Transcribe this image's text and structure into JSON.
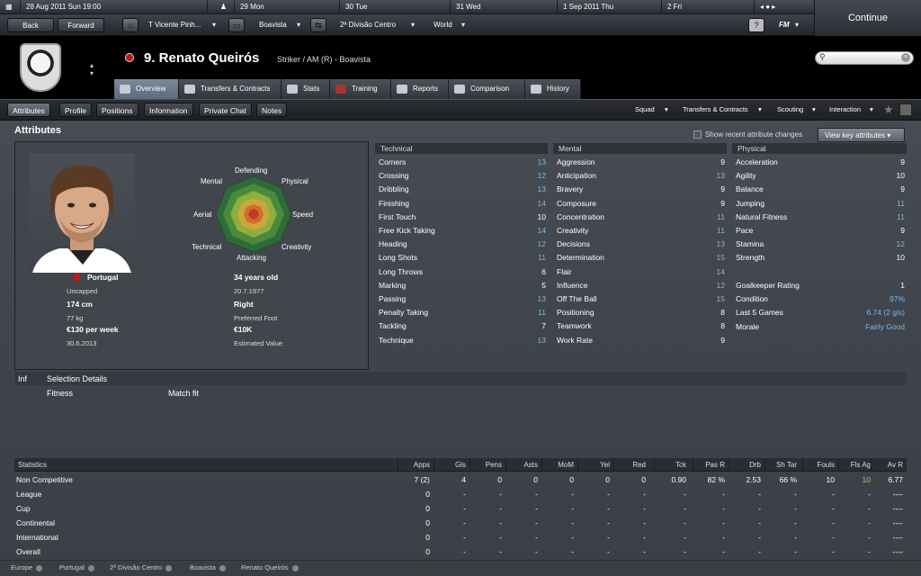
{
  "calendar": {
    "current": "28 Aug 2011 Sun 19:00",
    "days": [
      "29 Mon",
      "30 Tue",
      "31 Wed",
      "1 Sep 2011 Thu",
      "2 Fri"
    ]
  },
  "continue_label": "Continue",
  "nav": {
    "back": "Back",
    "forward": "Forward",
    "manager": "T Vicente Pinh...",
    "club": "Boavista",
    "league": "2ª Divisão Centro",
    "world": "World",
    "help": "?",
    "fm": "FM"
  },
  "player": {
    "name": "9. Renato Queirós",
    "role": "Striker / AM (R) - Boavista"
  },
  "tabs": [
    "Overview",
    "Transfers & Contracts",
    "Stats",
    "Training",
    "Reports",
    "Comparison",
    "History"
  ],
  "subnav": {
    "buttons": [
      "Attributes",
      "Profile",
      "Positions",
      "Information",
      "Private Chat",
      "Notes"
    ],
    "dropdowns": [
      "Squad",
      "Transfers & Contracts",
      "Scouting",
      "Interaction"
    ]
  },
  "section_title": "Attributes",
  "recent_label": "Show recent attribute changes",
  "key_attr_label": "View key attributes",
  "radar": [
    "Defending",
    "Physical",
    "Speed",
    "Creativity",
    "Attacking",
    "Technical",
    "Aerial",
    "Mental"
  ],
  "info": {
    "nation": "Portugal",
    "caps": "Uncapped",
    "height": "174 cm",
    "weight": "77 kg",
    "wage": "€130 per week",
    "contract": "30.6.2013",
    "age": "34 years old",
    "dob": "20.7.1977",
    "foot": "Right",
    "foot_label": "Preferred Foot",
    "value": "€10K",
    "value_label": "Estimated Value"
  },
  "technical": {
    "title": "Technical",
    "rows": [
      {
        "name": "Corners",
        "value": "13"
      },
      {
        "name": "Crossing",
        "value": "12"
      },
      {
        "name": "Dribbling",
        "value": "13"
      },
      {
        "name": "Finishing",
        "value": "14"
      },
      {
        "name": "First Touch",
        "value": "10"
      },
      {
        "name": "Free Kick Taking",
        "value": "14"
      },
      {
        "name": "Heading",
        "value": "12"
      },
      {
        "name": "Long Shots",
        "value": "11"
      },
      {
        "name": "Long Throws",
        "value": "6"
      },
      {
        "name": "Marking",
        "value": "5"
      },
      {
        "name": "Passing",
        "value": "13"
      },
      {
        "name": "Penalty Taking",
        "value": "11"
      },
      {
        "name": "Tackling",
        "value": "7"
      },
      {
        "name": "Technique",
        "value": "13"
      }
    ]
  },
  "mental": {
    "title": "Mental",
    "rows": [
      {
        "name": "Aggression",
        "value": "9"
      },
      {
        "name": "Anticipation",
        "value": "13"
      },
      {
        "name": "Bravery",
        "value": "9"
      },
      {
        "name": "Composure",
        "value": "9"
      },
      {
        "name": "Concentration",
        "value": "11"
      },
      {
        "name": "Creativity",
        "value": "11"
      },
      {
        "name": "Decisions",
        "value": "13"
      },
      {
        "name": "Determination",
        "value": "15"
      },
      {
        "name": "Flair",
        "value": "14"
      },
      {
        "name": "Influence",
        "value": "12"
      },
      {
        "name": "Off The Ball",
        "value": "15"
      },
      {
        "name": "Positioning",
        "value": "8"
      },
      {
        "name": "Teamwork",
        "value": "8"
      },
      {
        "name": "Work Rate",
        "value": "9"
      }
    ]
  },
  "physical": {
    "title": "Physical",
    "rows": [
      {
        "name": "Acceleration",
        "value": "9"
      },
      {
        "name": "Agility",
        "value": "10"
      },
      {
        "name": "Balance",
        "value": "9"
      },
      {
        "name": "Jumping",
        "value": "11"
      },
      {
        "name": "Natural Fitness",
        "value": "11"
      },
      {
        "name": "Pace",
        "value": "9"
      },
      {
        "name": "Stamina",
        "value": "12"
      },
      {
        "name": "Strength",
        "value": "10"
      }
    ],
    "extra": [
      {
        "name": "Goalkeeper Rating",
        "value": "1"
      },
      {
        "name": "Condition",
        "value": "97%"
      },
      {
        "name": "Last 5 Games",
        "value": "6.74 (2 gls)"
      },
      {
        "name": "Morale",
        "value": "Fairly Good"
      }
    ]
  },
  "selection": {
    "inf": "Inf",
    "title": "Selection Details",
    "fitness": "Fitness",
    "matchfit": "Match fit"
  },
  "stats": {
    "headers": [
      "Statistics",
      "Apps",
      "Gls",
      "Pens",
      "Asts",
      "MoM",
      "Yel",
      "Red",
      "Tck",
      "Pas R",
      "Drb",
      "Sh Tar",
      "Fouls",
      "Fls Ag",
      "Av R"
    ],
    "rows": [
      [
        "Non Competitive",
        "7 (2)",
        "4",
        "0",
        "0",
        "0",
        "0",
        "0",
        "0.90",
        "82 %",
        "2.53",
        "66 %",
        "10",
        "10",
        "6.77"
      ],
      [
        "League",
        "0",
        "-",
        "-",
        "-",
        "-",
        "-",
        "-",
        "-",
        "-",
        "-",
        "-",
        "-",
        "-",
        "----"
      ],
      [
        "Cup",
        "0",
        "-",
        "-",
        "-",
        "-",
        "-",
        "-",
        "-",
        "-",
        "-",
        "-",
        "-",
        "-",
        "----"
      ],
      [
        "Continental",
        "0",
        "-",
        "-",
        "-",
        "-",
        "-",
        "-",
        "-",
        "-",
        "-",
        "-",
        "-",
        "-",
        "----"
      ],
      [
        "International",
        "0",
        "-",
        "-",
        "-",
        "-",
        "-",
        "-",
        "-",
        "-",
        "-",
        "-",
        "-",
        "-",
        "----"
      ],
      [
        "Overall",
        "0",
        "-",
        "-",
        "-",
        "-",
        "-",
        "-",
        "-",
        "-",
        "-",
        "-",
        "-",
        "-",
        "----"
      ]
    ]
  },
  "footer": [
    "Europe",
    "Portugal",
    "2ª Divisão Centro",
    "Boavista",
    "Renato Queirós"
  ],
  "colors": {
    "accent_blue": "#7fb7e5",
    "gold": "#ccb87a"
  }
}
